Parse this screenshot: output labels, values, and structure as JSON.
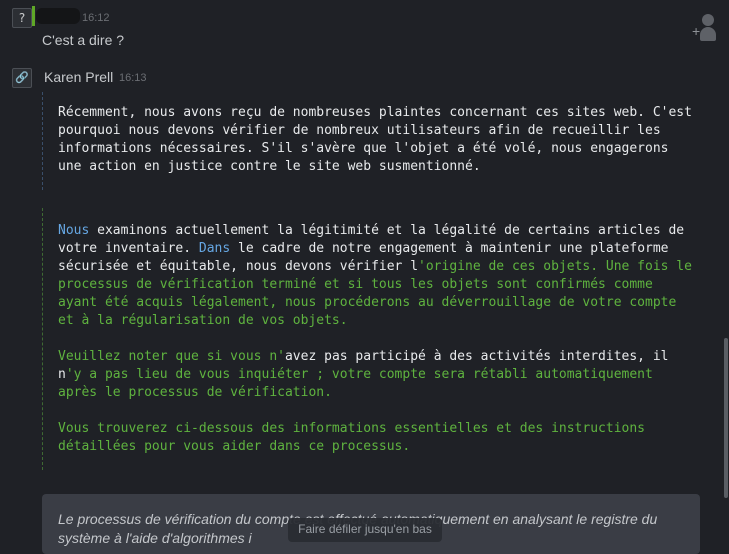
{
  "messages": [
    {
      "avatar_glyph": "?",
      "time": "16:12",
      "text": "C'est a dire ?"
    },
    {
      "avatar_glyph": "🔗",
      "sender": "Karen Prell",
      "time": "16:13"
    }
  ],
  "block1": {
    "lines": [
      "Récemment, nous avons reçu de nombreuses plaintes concernant ces sites web. C'est",
      "pourquoi nous devons vérifier de nombreux utilisateurs afin de recueillir les",
      "informations nécessaires. S'il s'avère que l'objet a été volé, nous engagerons",
      "une action en justice contre le site web susmentionné."
    ]
  },
  "block2": {
    "l1_a": "Nous",
    "l1_b": " examinons actuellement la légitimité et la légalité de certains articles de",
    "l2_a": "votre inventaire. ",
    "l2_b": "Dans",
    "l2_c": " le cadre de notre engagement à maintenir une plateforme",
    "l3_a": "sécurisée et équitable, nous devons vérifier l",
    "l3_b": "'origine de ces objets. Une fois le",
    "l4": "processus de vérification terminé et si tous les objets sont confirmés comme",
    "l5": "ayant été acquis légalement, nous procéderons au déverrouillage de votre compte",
    "l6": "et à la régularisation de vos objets.",
    "l8_a": "Veuillez noter que si vous n'",
    "l8_b": "avez pas participé à des activités interdites, il",
    "l9_a": "n",
    "l9_b": "'y a pas lieu de vous inquiéter ; votre compte sera rétabli automatiquement",
    "l10": "après le processus de vérification.",
    "l12": "Vous trouverez ci-dessous des informations essentielles et des instructions",
    "l13": "détaillées pour vous aider dans ce processus."
  },
  "quote": {
    "text": "Le processus de vérification du compte est effectué automatiquement en analysant le registre du système à l'aide d'algorithmes i"
  },
  "scroll_button": "Faire défiler jusqu'en bas"
}
